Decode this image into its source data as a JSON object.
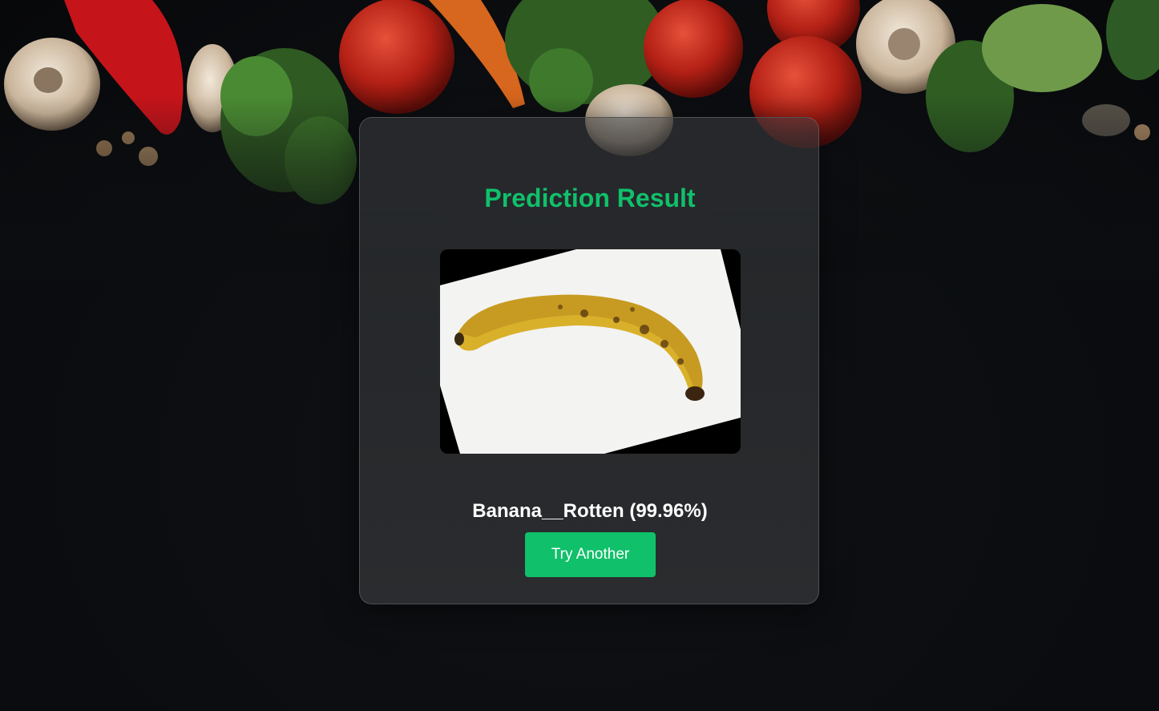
{
  "page": {
    "title": "Prediction Result",
    "result_label": "Banana__Rotten (99.96%)",
    "button_label": "Try Another"
  },
  "image": {
    "subject": "rotten banana photo",
    "alt": "Banana__Rotten"
  },
  "background": {
    "subject": "vegetables on dark surface"
  },
  "colors": {
    "accent": "#10c06a",
    "card_bg": "#2a2c2f",
    "page_bg": "#0b0d10",
    "text": "#ffffff"
  }
}
